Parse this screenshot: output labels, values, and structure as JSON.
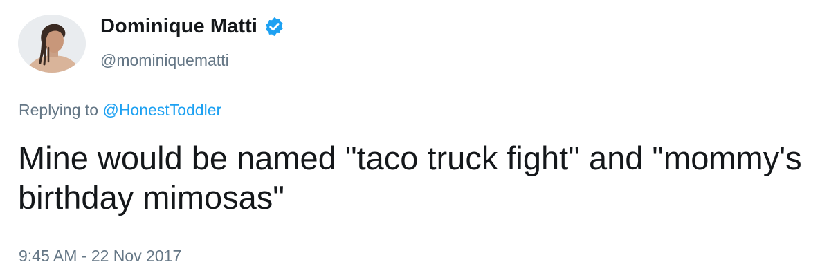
{
  "tweet": {
    "author": {
      "display_name": "Dominique Matti",
      "handle": "@mominiquematti",
      "verified": true,
      "avatar_icon": "user-avatar-photo"
    },
    "reply": {
      "prefix": "Replying to ",
      "mention": "@HonestToddler"
    },
    "text": "Mine would be named \"taco truck fight\" and \"mommy's birthday mimosas\"",
    "timestamp": "9:45 AM - 22 Nov 2017"
  },
  "colors": {
    "text": "#14171a",
    "secondary": "#657786",
    "accent": "#1da1f2"
  }
}
